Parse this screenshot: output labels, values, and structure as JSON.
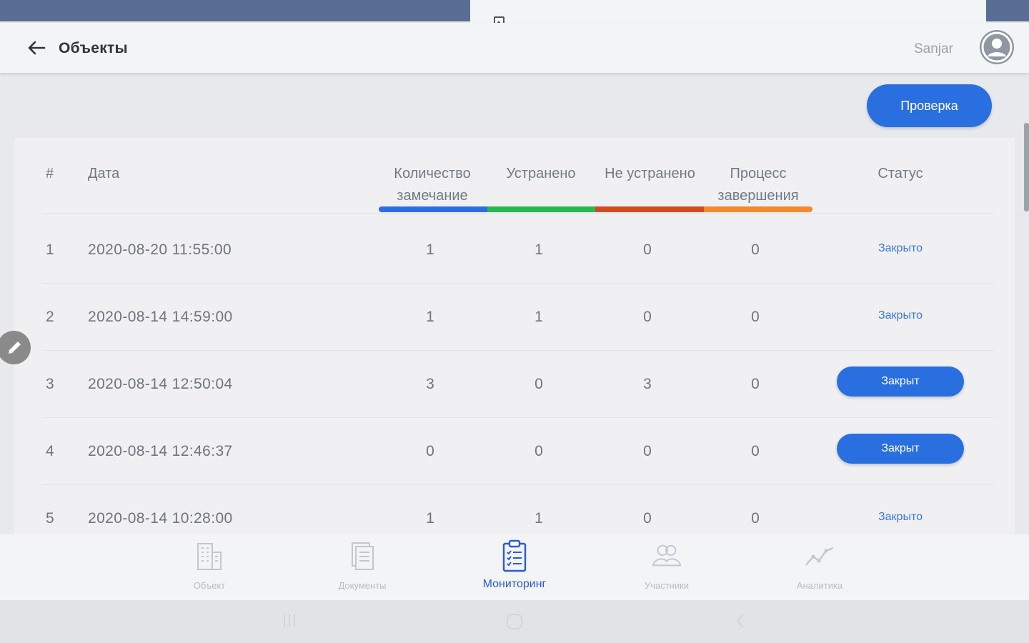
{
  "header": {
    "title": "Объекты",
    "user_name": "Sanjar"
  },
  "actions": {
    "check_label": "Проверка"
  },
  "table": {
    "columns": {
      "num": "#",
      "date": "Дата",
      "count_line1": "Количество",
      "count_line2": "замечание",
      "fixed": "Устранено",
      "not_fixed": "Не устранено",
      "process_line1": "Процесс",
      "process_line2": "завершения",
      "status": "Статус"
    },
    "indicator_colors": [
      "#2d6ee0",
      "#27b84f",
      "#d24a20",
      "#f08a2c"
    ],
    "rows": [
      {
        "num": "1",
        "date": "2020-08-20 11:55:00",
        "count": "1",
        "fixed": "1",
        "not_fixed": "0",
        "process": "0",
        "status": "Закрыто",
        "status_type": "link"
      },
      {
        "num": "2",
        "date": "2020-08-14 14:59:00",
        "count": "1",
        "fixed": "1",
        "not_fixed": "0",
        "process": "0",
        "status": "Закрыто",
        "status_type": "link"
      },
      {
        "num": "3",
        "date": "2020-08-14 12:50:04",
        "count": "3",
        "fixed": "0",
        "not_fixed": "3",
        "process": "0",
        "status": "Закрыт",
        "status_type": "button"
      },
      {
        "num": "4",
        "date": "2020-08-14 12:46:37",
        "count": "0",
        "fixed": "0",
        "not_fixed": "0",
        "process": "0",
        "status": "Закрыт",
        "status_type": "button"
      },
      {
        "num": "5",
        "date": "2020-08-14 10:28:00",
        "count": "1",
        "fixed": "1",
        "not_fixed": "0",
        "process": "0",
        "status": "Закрыто",
        "status_type": "link"
      }
    ]
  },
  "bottom_nav": {
    "items": [
      {
        "label": "Объект",
        "icon": "building-icon"
      },
      {
        "label": "Документы",
        "icon": "document-icon"
      },
      {
        "label": "Мониторинг",
        "icon": "clipboard-icon",
        "active": true
      },
      {
        "label": "Участники",
        "icon": "users-icon"
      },
      {
        "label": "Аналитика",
        "icon": "chart-line-icon"
      }
    ]
  },
  "colors": {
    "accent": "#2a6fe0",
    "status_bar": "#5a6d92"
  }
}
